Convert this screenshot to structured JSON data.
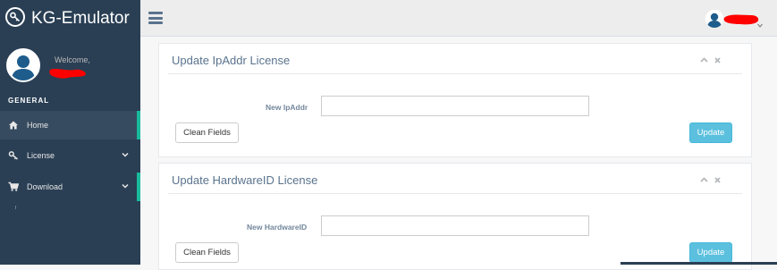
{
  "brand": {
    "name": "KG-Emulator",
    "icon": "key-icon"
  },
  "profile": {
    "welcome": "Welcome,",
    "avatar_icon": "user-avatar-icon"
  },
  "sidebar": {
    "section_title": "GENERAL",
    "items": [
      {
        "label": "Home",
        "icon": "home-icon",
        "has_chevron": false,
        "active": true
      },
      {
        "label": "License",
        "icon": "key-icon",
        "has_chevron": true,
        "active": false
      },
      {
        "label": "Download",
        "icon": "cart-icon",
        "has_chevron": true,
        "active": false
      }
    ]
  },
  "topnav": {
    "menu_icon": "hamburger-icon",
    "user_icon": "user-avatar-icon"
  },
  "panels": [
    {
      "title": "Update IpAddr License",
      "field_label": "New IpAddr",
      "field_value": "",
      "clean_label": "Clean Fields",
      "update_label": "Update"
    },
    {
      "title": "Update HardwareID License",
      "field_label": "New HardwareID",
      "field_value": "",
      "clean_label": "Clean Fields",
      "update_label": "Update"
    }
  ],
  "colors": {
    "sidebar": "#2A3F54",
    "accent": "#1ABB9C",
    "update_button": "#5BC0DE",
    "redaction": "#FF0000"
  }
}
